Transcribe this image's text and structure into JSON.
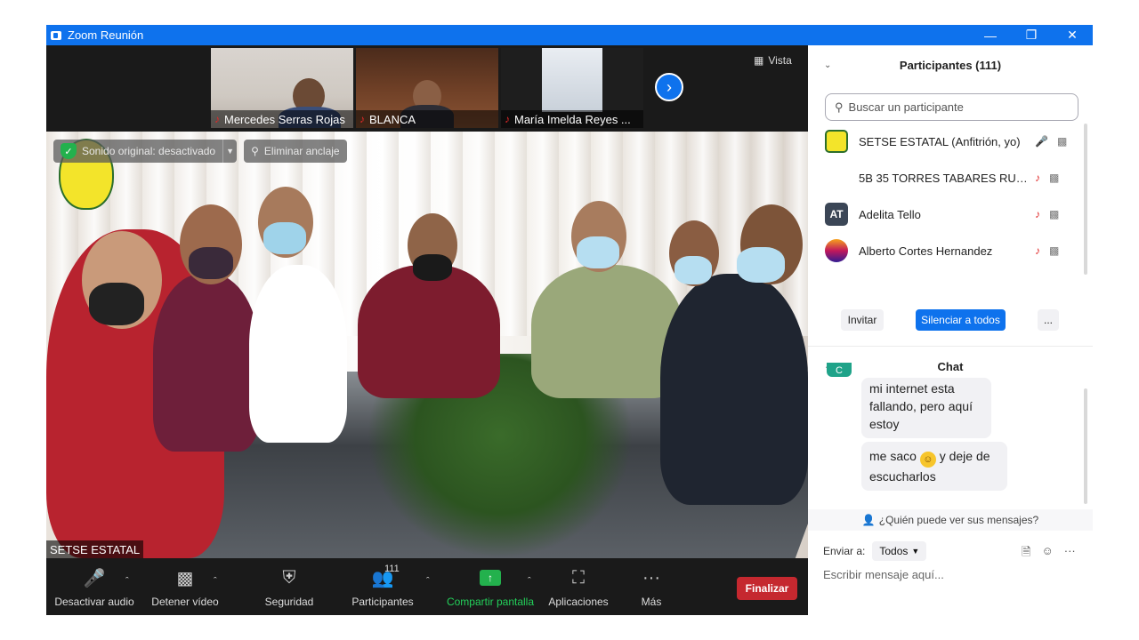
{
  "window": {
    "title": "Zoom Reunión"
  },
  "strip": {
    "thumbnails": [
      {
        "name": "Mercedes Serras Rojas"
      },
      {
        "name": "BLANCA"
      },
      {
        "name": "María Imelda Reyes ..."
      }
    ],
    "view_label": "Vista"
  },
  "main_video": {
    "original_sound": "Sonido original: desactivado",
    "unpin": "Eliminar anclaje",
    "speaker": "SETSE ESTATAL"
  },
  "toolbar": {
    "mute": "Desactivar audio",
    "video": "Detener vídeo",
    "security": "Seguridad",
    "participants": "Participantes",
    "participants_count": "111",
    "share": "Compartir pantalla",
    "apps": "Aplicaciones",
    "more": "Más",
    "end": "Finalizar"
  },
  "participants_panel": {
    "title": "Participantes (111)",
    "search_placeholder": "Buscar un participante",
    "list": [
      {
        "name": "SETSE ESTATAL (Anfitrión, yo)",
        "avatar": "",
        "mic": "on"
      },
      {
        "name": "5B 35 TORRES TABARES RUBEN ...",
        "avatar": "",
        "mic": "muted"
      },
      {
        "name": "Adelita Tello",
        "avatar": "AT",
        "mic": "muted"
      },
      {
        "name": "Alberto Cortes Hernandez",
        "avatar": "",
        "mic": "muted"
      }
    ],
    "invite": "Invitar",
    "mute_all": "Silenciar a todos",
    "more": "..."
  },
  "chat_panel": {
    "title": "Chat",
    "avatar_initial": "C",
    "messages": [
      {
        "lines": [
          "mi internet esta",
          "fallando, pero aquí",
          "estoy"
        ]
      },
      {
        "text_before": "me saco",
        "text_after": "y deje de",
        "line2": "escucharlos"
      }
    ],
    "who_can_see": "¿Quién puede ver sus mensajes?",
    "send_to_label": "Enviar a:",
    "send_to_value": "Todos",
    "compose_placeholder": "Escribir mensaje aquí..."
  },
  "colors": {
    "titlebar": "#0e72ed",
    "end_button": "#c5282f",
    "share_green": "#23b14d",
    "muted_red": "#e02828"
  }
}
